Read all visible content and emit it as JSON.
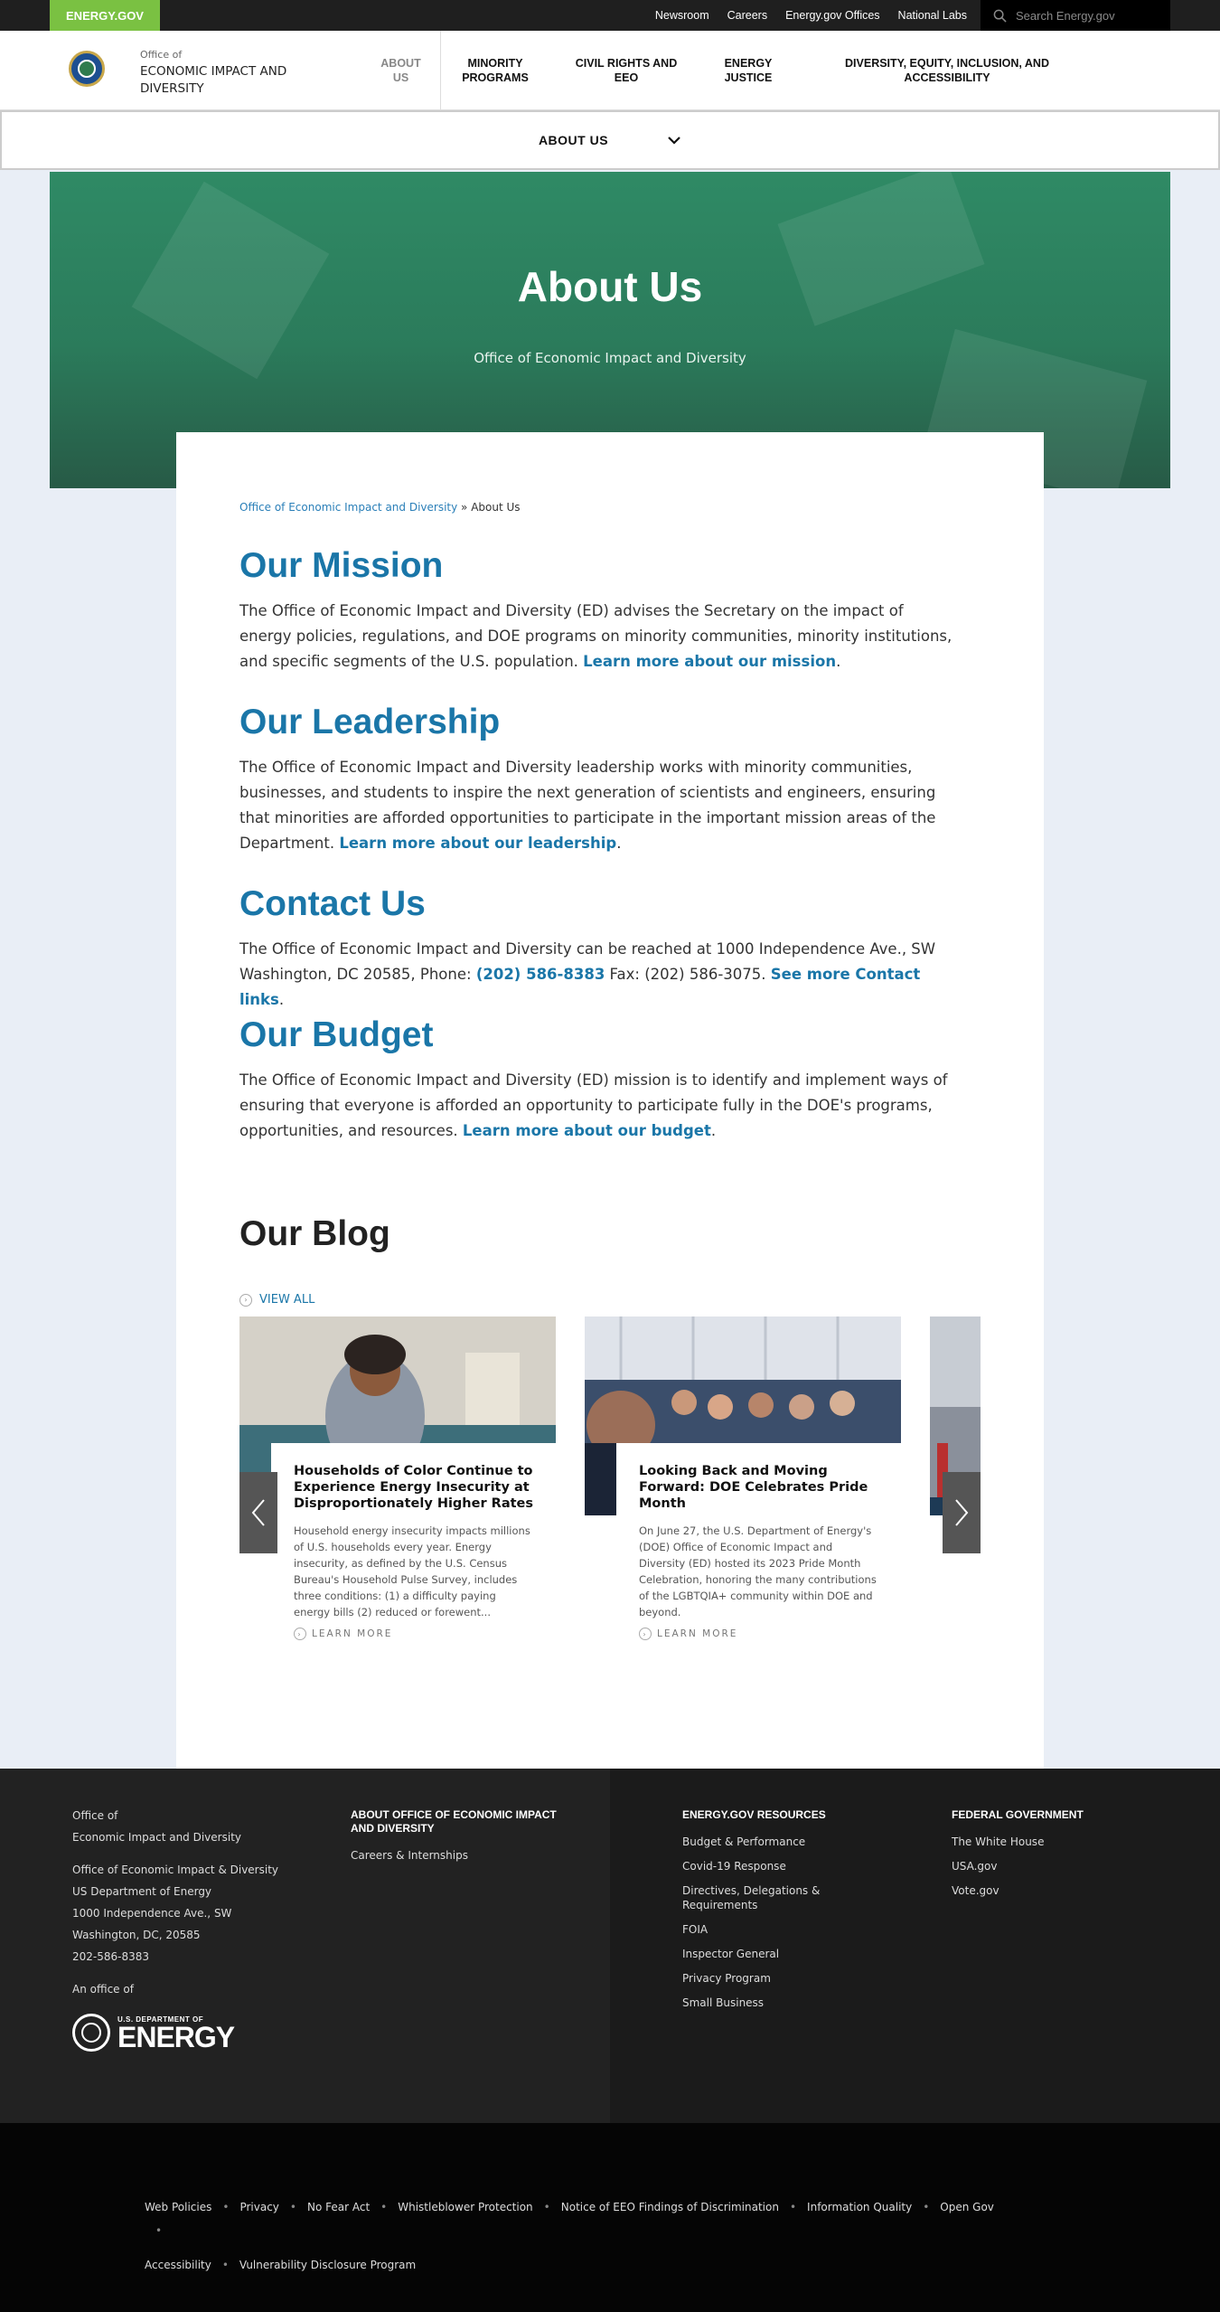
{
  "topbar": {
    "brand": "ENERGY.GOV",
    "links": [
      "Newsroom",
      "Careers",
      "Energy.gov Offices",
      "National Labs"
    ],
    "search_placeholder": "Search Energy.gov"
  },
  "header": {
    "office_prefix": "Office of",
    "office_name": "ECONOMIC IMPACT AND DIVERSITY",
    "about": "ABOUT US",
    "nav": [
      "MINORITY PROGRAMS",
      "CIVIL RIGHTS AND EEO",
      "ENERGY JUSTICE",
      "DIVERSITY, EQUITY, INCLUSION, AND ACCESSIBILITY"
    ]
  },
  "subnav": {
    "label": "ABOUT US"
  },
  "hero": {
    "title": "About Us",
    "subtitle": "Office of Economic Impact and Diversity"
  },
  "breadcrumb": {
    "link": "Office of Economic Impact and Diversity",
    "sep": " » ",
    "current": "About Us"
  },
  "sections": [
    {
      "title": "Our Mission",
      "body": "The Office of Economic Impact and Diversity (ED) advises the Secretary on the impact of energy policies, regulations, and DOE programs on minority communities, minority institutions, and specific segments of the U.S. population. ",
      "link": "Learn more about our mission",
      "tail": "."
    },
    {
      "title": "Our Leadership",
      "body": "The Office of Economic Impact and Diversity leadership works with minority communities, businesses, and students to inspire the next generation of scientists and engineers, ensuring that minorities are afforded opportunities to participate in the important mission areas of the Department. ",
      "link": "Learn more about our leadership",
      "tail": "."
    },
    {
      "title": "Contact Us",
      "body": "The Office of Economic Impact and Diversity can be reached at 1000 Independence Ave., SW Washington, DC 20585, Phone: ",
      "phone": "(202) 586-8383",
      "fax": " Fax: (202) 586-3075. ",
      "link": "See more Contact links",
      "tail": "."
    },
    {
      "title": "Our Budget",
      "body": "The Office of Economic Impact and Diversity (ED) mission is to identify and implement ways of ensuring that everyone is afforded an opportunity to participate fully in the DOE's programs, opportunities, and resources. ",
      "link": "Learn more about our budget",
      "tail": "."
    }
  ],
  "blog": {
    "title": "Our Blog",
    "view_all": "VIEW ALL",
    "cards": [
      {
        "title": "Households of Color Continue to Experience Energy Insecurity at Disproportionately Higher Rates",
        "excerpt": "Household energy insecurity impacts millions of U.S. households every year. Energy insecurity, as defined by the U.S. Census Bureau's Household Pulse Survey, includes three conditions: (1) a difficulty paying energy bills (2) reduced or forewent...",
        "cta": "LEARN MORE"
      },
      {
        "title": "Looking Back and Moving Forward: DOE Celebrates Pride Month",
        "excerpt": "On June 27, the U.S. Department of Energy's (DOE) Office of Economic Impact and Diversity (ED) hosted its 2023 Pride Month Celebration, honoring the many contributions of the LGBTQIA+ community within DOE and beyond.",
        "cta": "LEARN MORE"
      }
    ]
  },
  "footer": {
    "office_line1": "Office of",
    "office_line2": "Economic Impact and Diversity",
    "address": [
      "Office of Economic Impact & Diversity",
      "US Department of Energy",
      "1000 Independence Ave., SW",
      "Washington, DC, 20585",
      "202-586-8383"
    ],
    "an_office_of": "An office of",
    "doe_small": "U.S. DEPARTMENT OF",
    "doe_big": "ENERGY",
    "col_about_title": "ABOUT OFFICE OF ECONOMIC IMPACT AND DIVERSITY",
    "col_about_links": [
      "Careers & Internships"
    ],
    "col_res_title": "ENERGY.GOV RESOURCES",
    "col_res_links": [
      "Budget & Performance",
      "Covid-19 Response",
      "Directives, Delegations & Requirements",
      "FOIA",
      "Inspector General",
      "Privacy Program",
      "Small Business"
    ],
    "col_fed_title": "FEDERAL GOVERNMENT",
    "col_fed_links": [
      "The White House",
      "USA.gov",
      "Vote.gov"
    ]
  },
  "bottom_links": [
    "Web Policies",
    "Privacy",
    "No Fear Act",
    "Whistleblower Protection",
    "Notice of EEO Findings of Discrimination",
    "Information Quality",
    "Open Gov",
    "Accessibility",
    "Vulnerability Disclosure Program"
  ],
  "colors": {
    "brand_green": "#7ac142",
    "link_blue": "#1a76a8",
    "hero_green": "#2b7b5b"
  }
}
